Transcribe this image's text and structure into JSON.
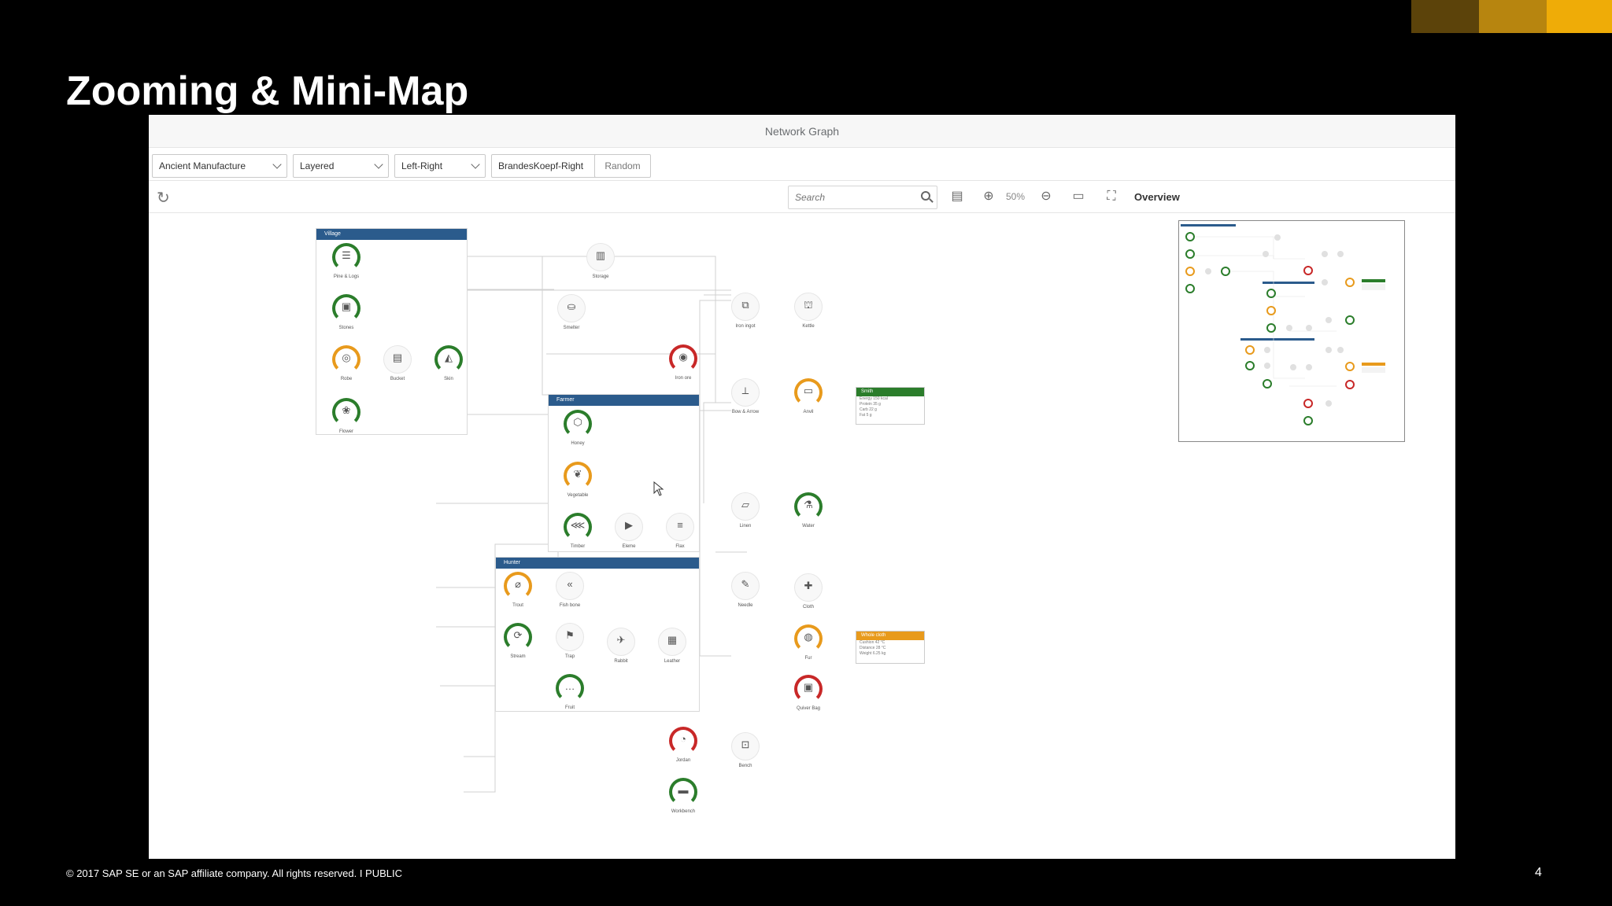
{
  "slide": {
    "title": "Zooming & Mini-Map",
    "footer": "© 2017 SAP SE or an SAP affiliate company. All rights reserved.   I   PUBLIC",
    "page_number": "4",
    "colors": {
      "bar_dark": "#5c430a",
      "bar_mid": "#b7850f",
      "bar_light": "#efac07"
    }
  },
  "app": {
    "title": "Network Graph",
    "toolbar": {
      "dataset": "Ancient Manufacture",
      "layout": "Layered",
      "orientation": "Left-Right",
      "alignment": "BrandesKoepf-Right",
      "random_label": "Random"
    },
    "tools": {
      "search_placeholder": "Search",
      "zoom_level": "50%",
      "overview_label": "Overview"
    }
  },
  "graph": {
    "groups": [
      {
        "id": "g1",
        "title": "Village"
      },
      {
        "id": "g2",
        "title": "Farmer"
      },
      {
        "id": "g3",
        "title": "Hunter"
      }
    ],
    "nodes": [
      {
        "id": "n1",
        "label": "Pine & Logs",
        "status": "green",
        "glyph": "☰"
      },
      {
        "id": "n2",
        "label": "Stones",
        "status": "green",
        "glyph": "▣"
      },
      {
        "id": "n3",
        "label": "Robe",
        "status": "orange",
        "glyph": "◎"
      },
      {
        "id": "n4",
        "label": "Bucket",
        "status": "none",
        "glyph": "▤"
      },
      {
        "id": "n5",
        "label": "Skin",
        "status": "green",
        "glyph": "◭"
      },
      {
        "id": "n6",
        "label": "Flower",
        "status": "green",
        "glyph": "❀"
      },
      {
        "id": "n7",
        "label": "Storage",
        "status": "none",
        "glyph": "▥"
      },
      {
        "id": "n8",
        "label": "Smelter",
        "status": "none",
        "glyph": "⛀"
      },
      {
        "id": "n9",
        "label": "Iron ore",
        "status": "red",
        "glyph": "◉"
      },
      {
        "id": "n10",
        "label": "Iron ingot",
        "status": "none",
        "glyph": "⧉"
      },
      {
        "id": "n11",
        "label": "Kettle",
        "status": "none",
        "glyph": "⛫"
      },
      {
        "id": "n12",
        "label": "Bow & Arrow",
        "status": "none",
        "glyph": "⟂"
      },
      {
        "id": "n13",
        "label": "Anvil",
        "status": "orange",
        "glyph": "▭"
      },
      {
        "id": "n14",
        "label": "Honey",
        "status": "green",
        "glyph": "⬡"
      },
      {
        "id": "n15",
        "label": "Vegetable",
        "status": "orange",
        "glyph": "❦"
      },
      {
        "id": "n16",
        "label": "Timber",
        "status": "green",
        "glyph": "⋘"
      },
      {
        "id": "n17",
        "label": "Eleme",
        "status": "none",
        "glyph": "▶"
      },
      {
        "id": "n18",
        "label": "Flax",
        "status": "none",
        "glyph": "≡"
      },
      {
        "id": "n19",
        "label": "Linen",
        "status": "none",
        "glyph": "▱"
      },
      {
        "id": "n20",
        "label": "Water",
        "status": "green",
        "glyph": "⚗"
      },
      {
        "id": "n21",
        "label": "Trout",
        "status": "orange",
        "glyph": "⌀"
      },
      {
        "id": "n22",
        "label": "Fish bone",
        "status": "none",
        "glyph": "«"
      },
      {
        "id": "n23",
        "label": "Needle",
        "status": "none",
        "glyph": "✎"
      },
      {
        "id": "n24",
        "label": "Cloth",
        "status": "none",
        "glyph": "✚"
      },
      {
        "id": "n25",
        "label": "Stream",
        "status": "green",
        "glyph": "⟳"
      },
      {
        "id": "n26",
        "label": "Trap",
        "status": "none",
        "glyph": "⚑"
      },
      {
        "id": "n27",
        "label": "Rabbit",
        "status": "none",
        "glyph": "✈"
      },
      {
        "id": "n28",
        "label": "Leather",
        "status": "none",
        "glyph": "▦"
      },
      {
        "id": "n29",
        "label": "Fur",
        "status": "orange",
        "glyph": "◍"
      },
      {
        "id": "n30",
        "label": "Fruit",
        "status": "green",
        "glyph": "…"
      },
      {
        "id": "n31",
        "label": "Quiver Bag",
        "status": "red",
        "glyph": "▣"
      },
      {
        "id": "n32",
        "label": "Jordan",
        "status": "red",
        "glyph": "◔"
      },
      {
        "id": "n33",
        "label": "Bench",
        "status": "none",
        "glyph": "⊡"
      },
      {
        "id": "n34",
        "label": "Workbench",
        "status": "green",
        "glyph": "▬"
      }
    ],
    "cards": [
      {
        "id": "c1",
        "title": "Smith",
        "color": "#2b7d2b",
        "rows": [
          "Energy   150 kcal",
          "Protein   35 g",
          "Carb   22 g",
          "Fat   5 g"
        ]
      },
      {
        "id": "c2",
        "title": "Whole cloth",
        "color": "#e89a1c",
        "rows": [
          "Cushion   42 °C",
          "Distance   28 °C",
          "Weight   6.25 kg"
        ]
      }
    ]
  }
}
